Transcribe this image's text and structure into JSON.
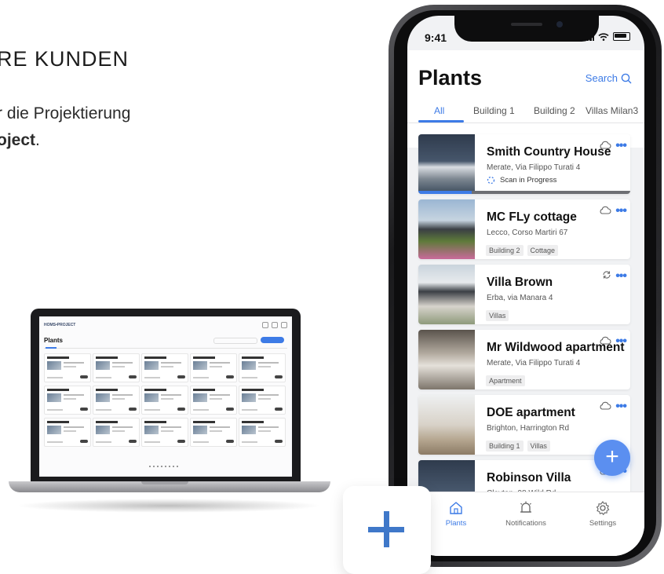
{
  "hero": {
    "title": "RE KUNDEN",
    "line1": "r die Projektierung",
    "line2_bold": "oject",
    "line2_end": "."
  },
  "laptop": {
    "brand": "HOMS•PROJECT",
    "page_title": "Plants"
  },
  "phone": {
    "status": {
      "time": "9:41"
    },
    "header": {
      "title": "Plants",
      "search_label": "Search"
    },
    "tabs": [
      {
        "label": "All"
      },
      {
        "label": "Building 1"
      },
      {
        "label": "Building 2"
      },
      {
        "label": "Villas Milan3"
      }
    ],
    "cards": [
      {
        "title": "Smith Country House",
        "address": "Merate, Via Filippo Turati 4",
        "status": "Scan in Progress",
        "progress": 0.25,
        "icon": "cloud-icon",
        "tags": []
      },
      {
        "title": "MC FLy cottage",
        "address": "Lecco, Corso Martiri 67",
        "icon": "cloud-icon",
        "tags": [
          "Building 2",
          "Cottage"
        ]
      },
      {
        "title": "Villa Brown",
        "address": "Erba, via Manara 4",
        "icon": "sync-icon",
        "tags": [
          "Villas"
        ]
      },
      {
        "title": "Mr Wildwood apartment",
        "address": "Merate, Via Filippo Turati 4",
        "icon": "cloud-icon",
        "tags": [
          "Apartment"
        ]
      },
      {
        "title": "DOE apartment",
        "address": "Brighton,  Harrington Rd",
        "icon": "cloud-icon",
        "tags": [
          "Building 1",
          "Villas"
        ]
      },
      {
        "title": "Robinson Villa",
        "address": "Clayton, 98 Wild Rd",
        "icon": "cloud-icon",
        "tags": []
      }
    ],
    "nav": [
      {
        "label": "Plants"
      },
      {
        "label": "Notifications"
      },
      {
        "label": "Settings"
      }
    ]
  },
  "colors": {
    "accent": "#3d7be6",
    "fab": "#5b8ff0",
    "plus_tile": "#3f78c9"
  }
}
